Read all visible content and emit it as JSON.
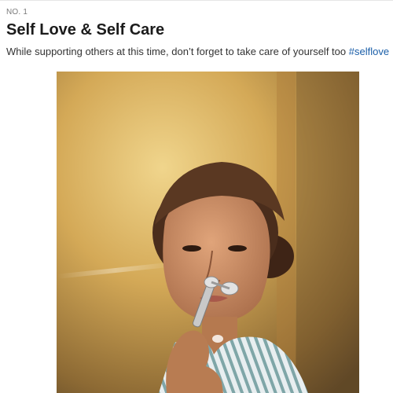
{
  "article": {
    "number_label": "NO. 1",
    "title": "Self Love & Self Care",
    "caption_text": "While supporting others at this time, don’t forget to take care of yourself too ",
    "hashtag": "#selflove",
    "hashtag_color": "#1a5ea8"
  },
  "photo": {
    "subject": "woman-with-face-roller-selfie",
    "palette": {
      "background": "#cfa452",
      "skin": "#c98f66",
      "hair": "#4a2d1c",
      "shirt_stripe": "#7fa6a8",
      "roller_metal": "#bfbfbf"
    }
  }
}
